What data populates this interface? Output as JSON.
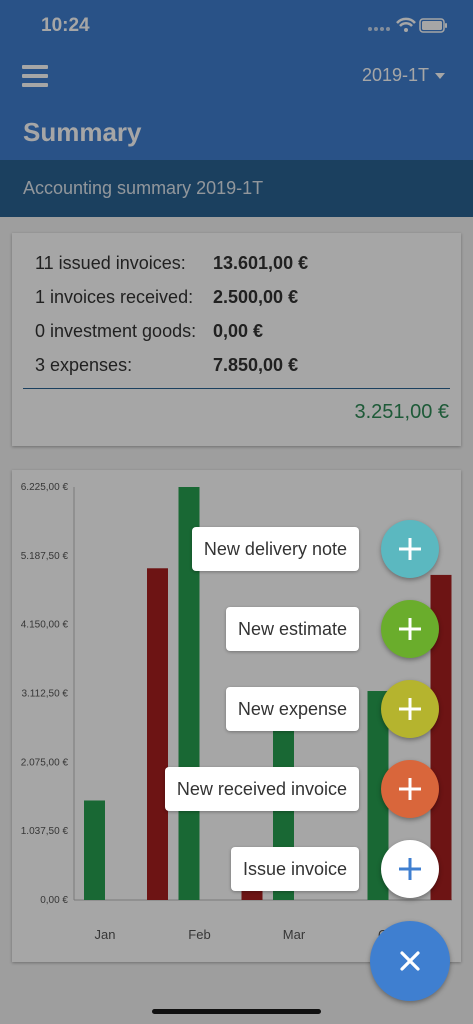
{
  "status_bar": {
    "time": "10:24"
  },
  "app_bar": {
    "period": "2019-1T",
    "title": "Summary"
  },
  "subheader": "Accounting summary 2019-1T",
  "summary": {
    "rows": [
      {
        "label": "11 issued invoices:",
        "value": "13.601,00 €"
      },
      {
        "label": "1 invoices received:",
        "value": "2.500,00 €"
      },
      {
        "label": "0 investment goods:",
        "value": "0,00 €"
      },
      {
        "label": "3 expenses:",
        "value": "7.850,00 €"
      }
    ],
    "total": "3.251,00 €"
  },
  "chart_data": {
    "type": "bar",
    "categories": [
      "Jan",
      "Feb",
      "Mar",
      "Oth"
    ],
    "y_tick_labels": [
      "6.225,00 €",
      "5.187,50 €",
      "4.150,00 €",
      "3.112,50 €",
      "2.075,00 €",
      "1.037,50 €",
      "0,00 €"
    ],
    "ylim": [
      0,
      6225
    ],
    "series": [
      {
        "color": "#27a050",
        "values": [
          1500,
          6225,
          3200,
          3150
        ]
      },
      {
        "color": "#a81f20",
        "values": [
          5000,
          500,
          0,
          4900
        ]
      }
    ]
  },
  "fab_menu": {
    "items": [
      {
        "label": "New delivery note",
        "color": "#5bb8c0",
        "icon": "plus-icon"
      },
      {
        "label": "New estimate",
        "color": "#6aad2c",
        "icon": "plus-icon"
      },
      {
        "label": "New expense",
        "color": "#b5b42e",
        "icon": "plus-icon"
      },
      {
        "label": "New received invoice",
        "color": "#d9663b",
        "icon": "plus-icon"
      },
      {
        "label": "Issue invoice",
        "color": "#ffffff",
        "icon": "plus-icon"
      }
    ],
    "close_color": "#3f7fd0",
    "close_icon": "close-icon"
  }
}
